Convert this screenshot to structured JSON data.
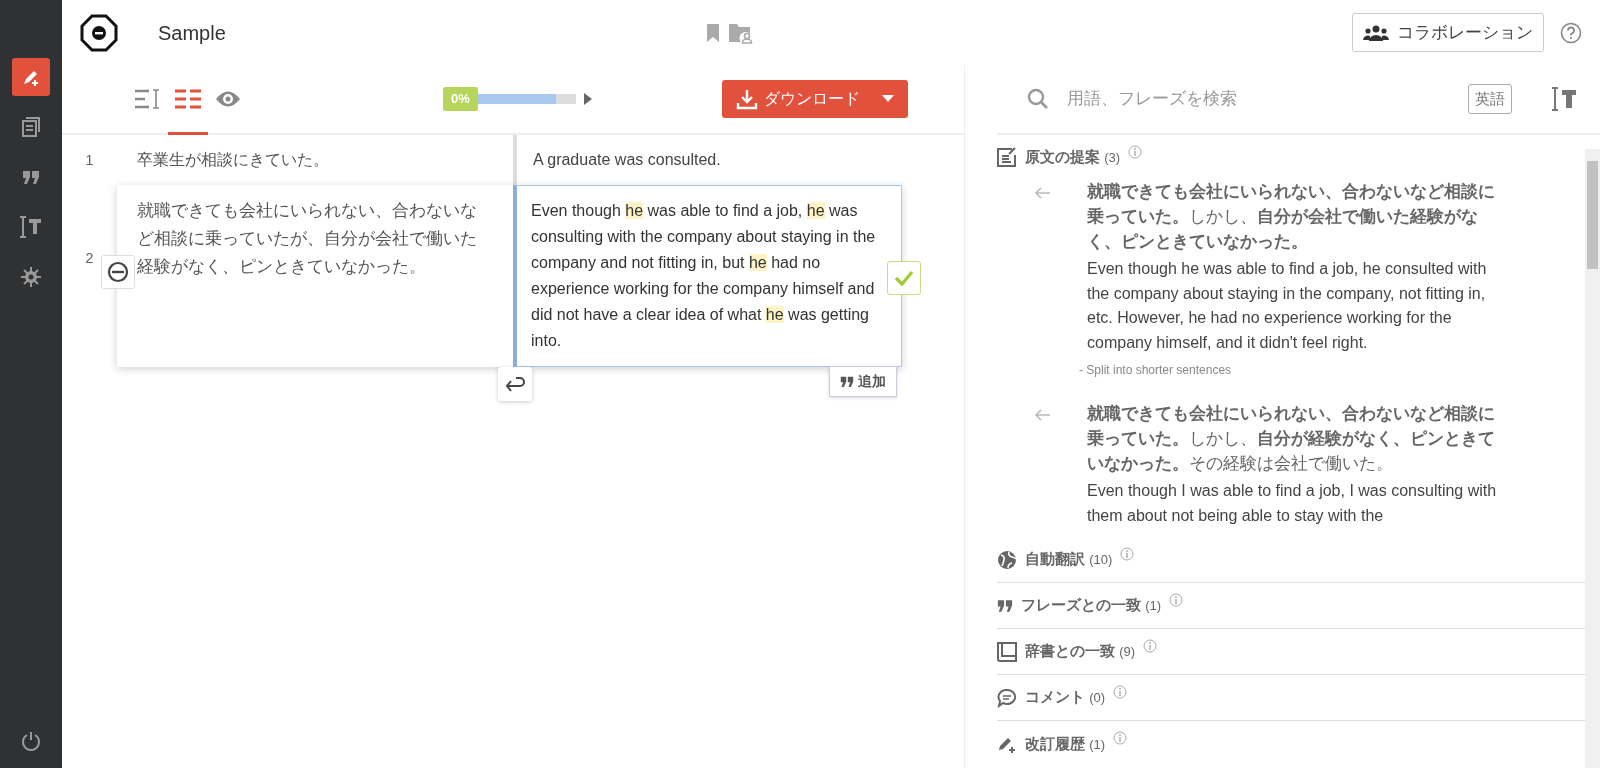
{
  "sidebar": {
    "items": [
      {
        "kind": "edit",
        "selected": true
      },
      {
        "kind": "document",
        "selected": false
      },
      {
        "kind": "quote",
        "selected": false
      },
      {
        "kind": "text-size",
        "selected": false
      },
      {
        "kind": "settings",
        "selected": false
      }
    ]
  },
  "header": {
    "title": "Sample",
    "collaboration_button": "コラボレーション"
  },
  "toolbar": {
    "views": [
      {
        "kind": "text",
        "selected": false
      },
      {
        "kind": "split",
        "selected": true
      },
      {
        "kind": "preview",
        "selected": false
      }
    ],
    "progress": {
      "label": "0%",
      "level": 0.8
    },
    "download_button": "ダウンロード"
  },
  "segments": [
    {
      "number": "1",
      "source": "卒業生が相談にきていた。",
      "target": [
        {
          "text": "A graduate was consulted.",
          "highlight": false
        }
      ],
      "active": false
    },
    {
      "number": "2",
      "source": "就職できても会社にいられない、合わないなど相談に乗っていたが、自分が会社で働いた経験がなく、ピンときていなかった。",
      "target": [
        {
          "text": "Even though ",
          "highlight": false
        },
        {
          "text": "he",
          "highlight": true
        },
        {
          "text": " was able to find a job, ",
          "highlight": false
        },
        {
          "text": "he",
          "highlight": true
        },
        {
          "text": " was consulting with the company about staying in the company and not fitting in, but ",
          "highlight": false
        },
        {
          "text": "he",
          "highlight": true
        },
        {
          "text": " had no experience working for the company himself and did not have a clear idea of what ",
          "highlight": false
        },
        {
          "text": "he",
          "highlight": true
        },
        {
          "text": " was getting into.",
          "highlight": false
        }
      ],
      "active": true
    }
  ],
  "add_button": "追加",
  "search": {
    "placeholder": "用語、フレーズを検索",
    "language_button": "英語"
  },
  "suggestions": {
    "title": "原文の提案",
    "count": "(3)",
    "items": [
      {
        "source": "**就職できても会社にいられない、合わないなど相談に乗っていた。**しかし、**自分が会社で働いた経験がなく、ピンときていなかった。**",
        "translation": "Even though he was able to find a job, he consulted with the company about staying in the company, not fitting in, etc. However, he had no experience working for the company himself, and it didn't feel right.",
        "note": "- Split into shorter sentences"
      },
      {
        "source": "**就職できても会社にいられない、合わないなど相談に乗っていた。**しかし、**自分が経験がなく、ピンときていなかった。**その経験は会社で働いた。",
        "translation": "Even though I was able to find a job, I was consulting with them about not being able to stay with the"
      }
    ]
  },
  "sections": [
    {
      "kind": "machine",
      "title": "自動翻訳",
      "count": "(10)"
    },
    {
      "kind": "phrase",
      "title": "フレーズとの一致",
      "count": "(1)"
    },
    {
      "kind": "dictionary",
      "title": "辞書との一致",
      "count": "(9)"
    },
    {
      "kind": "comment",
      "title": "コメント",
      "count": "(0)"
    },
    {
      "kind": "history",
      "title": "改訂履歴",
      "count": "(1)"
    }
  ]
}
